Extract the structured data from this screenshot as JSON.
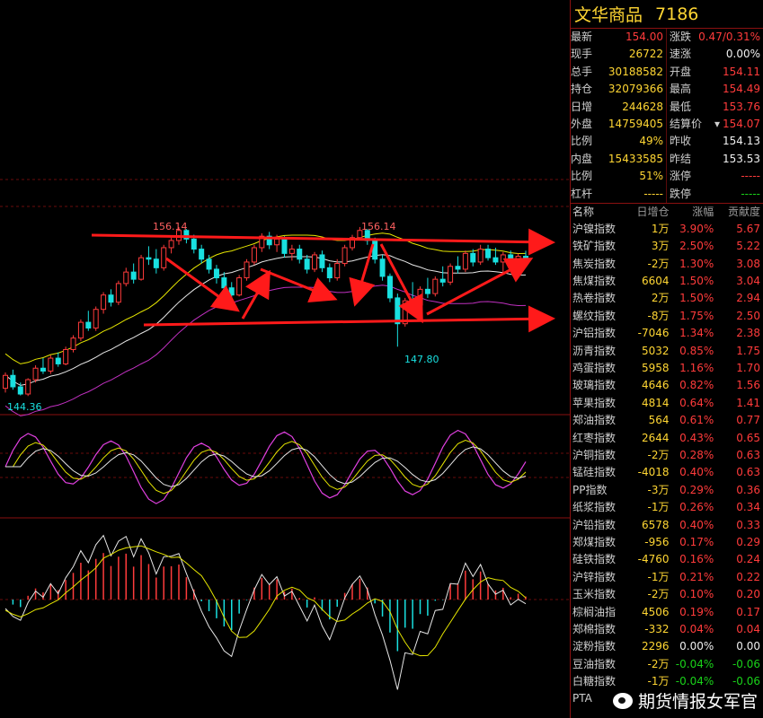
{
  "quote": {
    "title_name": "文华商品",
    "title_code": "7186",
    "rows": [
      {
        "l_label": "最新",
        "l_value": "154.00",
        "l_color": "red",
        "r_label": "涨跌",
        "r_value": "0.47/0.31%",
        "r_color": "red"
      },
      {
        "l_label": "现手",
        "l_value": "26722",
        "l_color": "yellow",
        "r_label": "速涨",
        "r_value": "0.00%",
        "r_color": "white"
      },
      {
        "l_label": "总手",
        "l_value": "30188582",
        "l_color": "yellow",
        "r_label": "开盘",
        "r_value": "154.11",
        "r_color": "red"
      },
      {
        "l_label": "持仓",
        "l_value": "32079366",
        "l_color": "yellow",
        "r_label": "最高",
        "r_value": "154.49",
        "r_color": "red"
      },
      {
        "l_label": "日增",
        "l_value": "244628",
        "l_color": "yellow",
        "r_label": "最低",
        "r_value": "153.76",
        "r_color": "red"
      },
      {
        "l_label": "外盘",
        "l_value": "14759405",
        "l_color": "yellow",
        "r_label": "结算价",
        "r_value": "154.07",
        "r_color": "red"
      },
      {
        "l_label": "比例",
        "l_value": "49%",
        "l_color": "yellow",
        "r_label": "昨收",
        "r_value": "154.13",
        "r_color": "white"
      },
      {
        "l_label": "内盘",
        "l_value": "15433585",
        "l_color": "yellow",
        "r_label": "昨结",
        "r_value": "153.53",
        "r_color": "white"
      },
      {
        "l_label": "比例",
        "l_value": "51%",
        "l_color": "yellow",
        "r_label": "涨停",
        "r_value": "-----",
        "r_color": "red"
      },
      {
        "l_label": "杠杆",
        "l_value": "-----",
        "l_color": "yellow",
        "r_label": "跌停",
        "r_value": "-----",
        "r_color": "green"
      }
    ]
  },
  "list": {
    "headers": [
      "名称",
      "日增仓",
      "涨幅",
      "贡献度"
    ],
    "rows": [
      {
        "name": "沪镍指数",
        "oi": "1万",
        "chg": "3.90%",
        "contrib": "5.67",
        "color": "red"
      },
      {
        "name": "铁矿指数",
        "oi": "3万",
        "chg": "2.50%",
        "contrib": "5.22",
        "color": "red"
      },
      {
        "name": "焦炭指数",
        "oi": "-2万",
        "chg": "1.30%",
        "contrib": "3.08",
        "color": "red"
      },
      {
        "name": "焦煤指数",
        "oi": "6604",
        "chg": "1.50%",
        "contrib": "3.04",
        "color": "red"
      },
      {
        "name": "热卷指数",
        "oi": "2万",
        "chg": "1.50%",
        "contrib": "2.94",
        "color": "red"
      },
      {
        "name": "螺纹指数",
        "oi": "-8万",
        "chg": "1.75%",
        "contrib": "2.50",
        "color": "red"
      },
      {
        "name": "沪铝指数",
        "oi": "-7046",
        "chg": "1.34%",
        "contrib": "2.38",
        "color": "red"
      },
      {
        "name": "沥青指数",
        "oi": "5032",
        "chg": "0.85%",
        "contrib": "1.75",
        "color": "red"
      },
      {
        "name": "鸡蛋指数",
        "oi": "5958",
        "chg": "1.16%",
        "contrib": "1.70",
        "color": "red"
      },
      {
        "name": "玻璃指数",
        "oi": "4646",
        "chg": "0.82%",
        "contrib": "1.56",
        "color": "red"
      },
      {
        "name": "苹果指数",
        "oi": "4814",
        "chg": "0.64%",
        "contrib": "1.41",
        "color": "red"
      },
      {
        "name": "郑油指数",
        "oi": "564",
        "chg": "0.61%",
        "contrib": "0.77",
        "color": "red"
      },
      {
        "name": "红枣指数",
        "oi": "2644",
        "chg": "0.43%",
        "contrib": "0.65",
        "color": "red"
      },
      {
        "name": "沪铜指数",
        "oi": "-2万",
        "chg": "0.28%",
        "contrib": "0.63",
        "color": "red"
      },
      {
        "name": "锰硅指数",
        "oi": "-4018",
        "chg": "0.40%",
        "contrib": "0.63",
        "color": "red"
      },
      {
        "name": "PP指数",
        "oi": "-3万",
        "chg": "0.29%",
        "contrib": "0.36",
        "color": "red"
      },
      {
        "name": "纸浆指数",
        "oi": "-1万",
        "chg": "0.26%",
        "contrib": "0.34",
        "color": "red"
      },
      {
        "name": "沪铅指数",
        "oi": "6578",
        "chg": "0.40%",
        "contrib": "0.33",
        "color": "red"
      },
      {
        "name": "郑煤指数",
        "oi": "-956",
        "chg": "0.17%",
        "contrib": "0.29",
        "color": "red"
      },
      {
        "name": "硅铁指数",
        "oi": "-4760",
        "chg": "0.16%",
        "contrib": "0.24",
        "color": "red"
      },
      {
        "name": "沪锌指数",
        "oi": "-1万",
        "chg": "0.21%",
        "contrib": "0.22",
        "color": "red"
      },
      {
        "name": "玉米指数",
        "oi": "-2万",
        "chg": "0.10%",
        "contrib": "0.20",
        "color": "red"
      },
      {
        "name": "棕榈油指",
        "oi": "4506",
        "chg": "0.19%",
        "contrib": "0.17",
        "color": "red"
      },
      {
        "name": "郑棉指数",
        "oi": "-332",
        "chg": "0.04%",
        "contrib": "0.04",
        "color": "red"
      },
      {
        "name": "淀粉指数",
        "oi": "2296",
        "chg": "0.00%",
        "contrib": "0.00",
        "color": "white"
      },
      {
        "name": "豆油指数",
        "oi": "-2万",
        "chg": "-0.04%",
        "contrib": "-0.06",
        "color": "green"
      },
      {
        "name": "白糖指数",
        "oi": "-1万",
        "chg": "-0.04%",
        "contrib": "-0.06",
        "color": "green"
      },
      {
        "name": "PTA",
        "oi": "",
        "chg": "",
        "contrib": "",
        "color": "green"
      }
    ]
  },
  "chart_data": {
    "type": "candlestick",
    "price_labels": {
      "high_left": "156.14",
      "high_right": "156.14",
      "low_mid": "147.80",
      "low_left": "144.36"
    },
    "trend_upper": [
      [
        102,
        262
      ],
      [
        612,
        270
      ]
    ],
    "trend_lower": [
      [
        160,
        362
      ],
      [
        612,
        355
      ]
    ],
    "candles": [
      [
        144.9,
        146.0,
        144.6,
        145.8
      ],
      [
        145.8,
        146.2,
        144.8,
        145.0
      ],
      [
        145.0,
        145.3,
        144.4,
        144.5
      ],
      [
        144.5,
        145.6,
        144.36,
        145.5
      ],
      [
        145.5,
        146.5,
        145.3,
        146.3
      ],
      [
        146.3,
        147.0,
        145.9,
        146.1
      ],
      [
        146.1,
        147.2,
        145.9,
        147.0
      ],
      [
        147.0,
        147.4,
        146.4,
        146.6
      ],
      [
        146.6,
        147.8,
        146.5,
        147.6
      ],
      [
        147.6,
        148.6,
        147.4,
        148.4
      ],
      [
        148.4,
        149.7,
        148.2,
        149.5
      ],
      [
        149.5,
        150.3,
        148.9,
        149.1
      ],
      [
        149.1,
        150.6,
        148.9,
        150.4
      ],
      [
        150.4,
        151.6,
        150.1,
        151.4
      ],
      [
        151.4,
        151.8,
        150.6,
        150.9
      ],
      [
        150.9,
        152.4,
        150.7,
        152.2
      ],
      [
        152.2,
        153.3,
        152.0,
        153.0
      ],
      [
        153.0,
        153.6,
        152.2,
        152.5
      ],
      [
        152.5,
        154.2,
        152.4,
        154.0
      ],
      [
        154.0,
        154.8,
        153.5,
        153.9
      ],
      [
        153.9,
        154.6,
        152.9,
        153.3
      ],
      [
        153.3,
        154.9,
        153.1,
        154.7
      ],
      [
        154.7,
        155.4,
        154.3,
        155.2
      ],
      [
        155.2,
        156.14,
        154.9,
        155.9
      ],
      [
        155.9,
        156.0,
        155.0,
        155.3
      ],
      [
        155.3,
        155.6,
        154.3,
        154.6
      ],
      [
        154.6,
        154.9,
        153.6,
        153.9
      ],
      [
        153.9,
        154.2,
        152.9,
        153.2
      ],
      [
        153.2,
        153.5,
        152.2,
        152.6
      ],
      [
        152.6,
        153.0,
        151.6,
        151.9
      ],
      [
        151.9,
        152.3,
        151.0,
        151.4
      ],
      [
        151.4,
        152.8,
        151.3,
        152.6
      ],
      [
        152.6,
        153.9,
        152.4,
        153.7
      ],
      [
        153.7,
        154.9,
        153.5,
        154.7
      ],
      [
        154.7,
        155.7,
        154.4,
        155.5
      ],
      [
        155.5,
        155.8,
        154.6,
        154.9
      ],
      [
        154.9,
        155.6,
        154.4,
        155.3
      ],
      [
        155.3,
        155.5,
        154.0,
        154.3
      ],
      [
        154.3,
        154.9,
        153.8,
        154.6
      ],
      [
        154.6,
        154.9,
        153.6,
        153.9
      ],
      [
        153.9,
        154.2,
        152.9,
        153.2
      ],
      [
        153.2,
        154.4,
        153.0,
        154.2
      ],
      [
        154.2,
        154.5,
        153.0,
        153.3
      ],
      [
        153.3,
        153.6,
        152.3,
        152.6
      ],
      [
        152.6,
        153.9,
        152.4,
        153.6
      ],
      [
        153.6,
        154.9,
        153.4,
        154.7
      ],
      [
        154.7,
        155.6,
        154.5,
        155.4
      ],
      [
        155.4,
        156.14,
        155.2,
        155.9
      ],
      [
        155.9,
        156.0,
        154.9,
        155.2
      ],
      [
        155.2,
        155.4,
        153.6,
        153.9
      ],
      [
        153.9,
        154.2,
        152.4,
        152.7
      ],
      [
        152.7,
        152.9,
        150.9,
        151.2
      ],
      [
        151.2,
        151.5,
        147.8,
        149.4
      ],
      [
        149.4,
        151.2,
        149.2,
        151.0
      ],
      [
        151.0,
        152.3,
        150.4,
        150.7
      ],
      [
        150.7,
        152.0,
        150.5,
        151.8
      ],
      [
        151.8,
        152.6,
        151.2,
        151.5
      ],
      [
        151.5,
        152.7,
        151.3,
        152.5
      ],
      [
        152.5,
        153.4,
        152.0,
        152.3
      ],
      [
        152.3,
        153.6,
        152.1,
        153.4
      ],
      [
        153.4,
        154.1,
        152.9,
        153.2
      ],
      [
        153.2,
        154.5,
        153.0,
        154.3
      ],
      [
        154.3,
        154.6,
        153.4,
        153.7
      ],
      [
        153.7,
        154.9,
        153.5,
        154.6
      ],
      [
        154.6,
        154.9,
        153.8,
        154.0
      ],
      [
        154.0,
        154.7,
        153.5,
        153.7
      ],
      [
        153.7,
        154.4,
        153.0,
        154.2
      ],
      [
        154.2,
        154.5,
        153.4,
        153.6
      ],
      [
        153.6,
        154.3,
        153.2,
        154.1
      ],
      [
        154.1,
        154.49,
        153.76,
        154.0
      ]
    ],
    "y_range": [
      143.5,
      157.2
    ]
  }
}
